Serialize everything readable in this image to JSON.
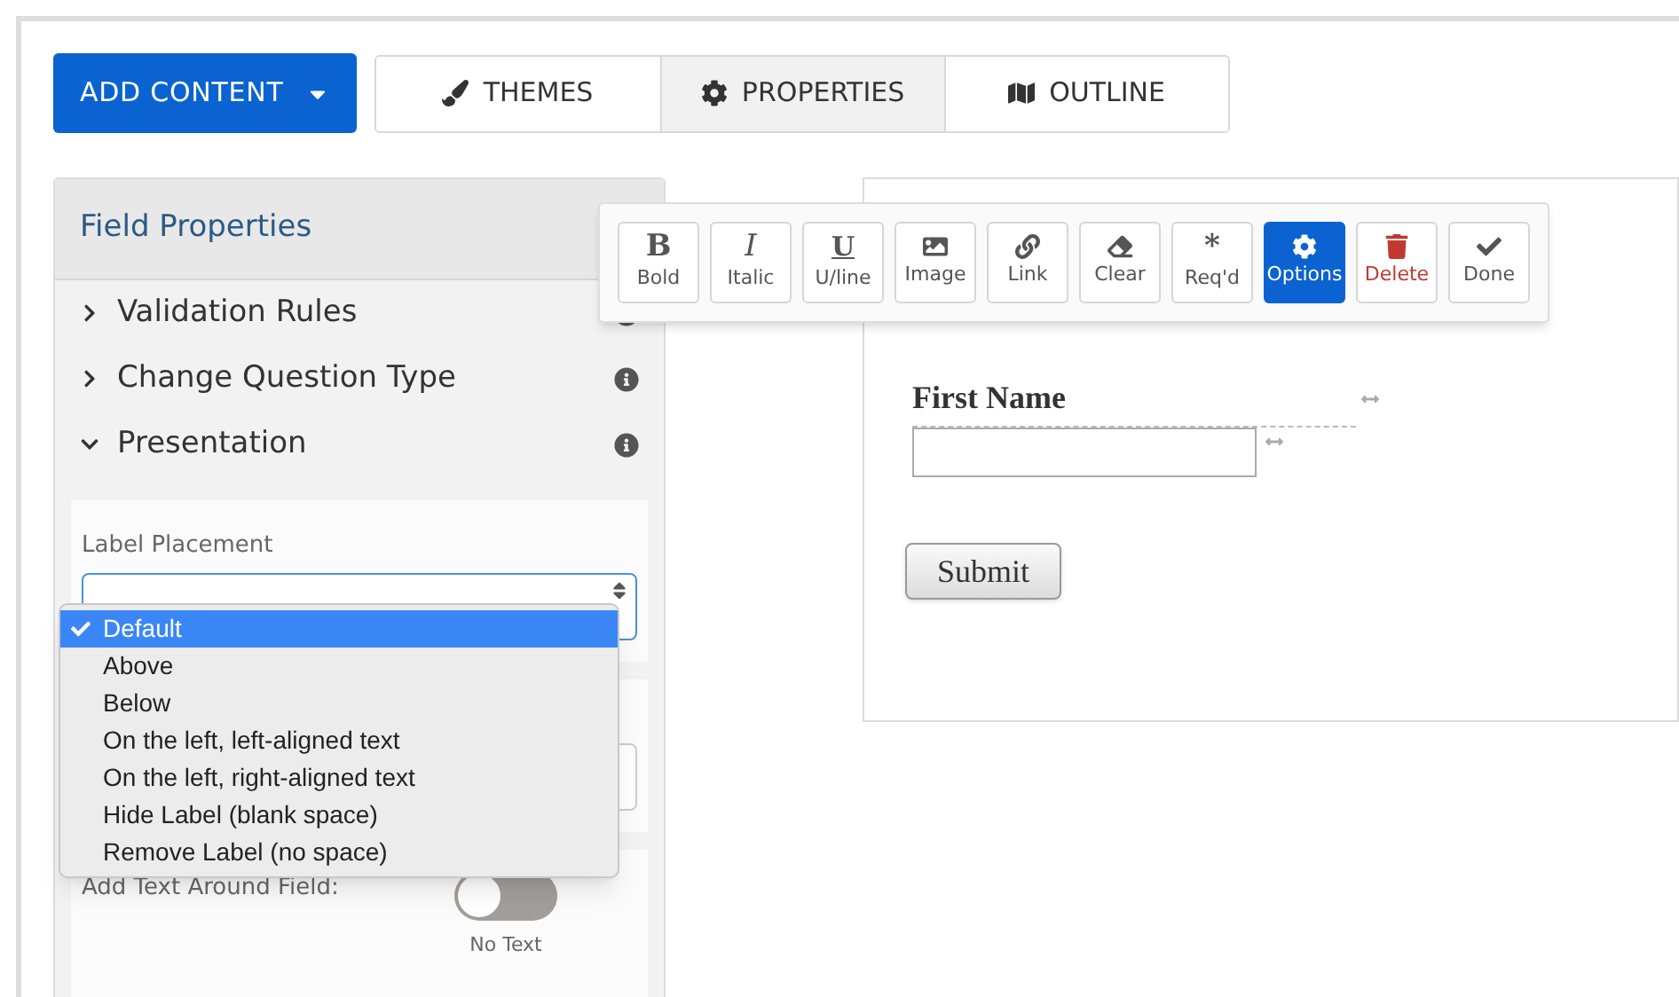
{
  "add_content": {
    "label": "ADD CONTENT"
  },
  "tabs": [
    {
      "label": "THEMES",
      "kind": "brush",
      "selected": false
    },
    {
      "label": "PROPERTIES",
      "kind": "gear",
      "selected": true
    },
    {
      "label": "OUTLINE",
      "kind": "map",
      "selected": false
    }
  ],
  "panel": {
    "title": "Field Properties",
    "sections": [
      {
        "label": "Validation Rules",
        "expanded": false
      },
      {
        "label": "Change Question Type",
        "expanded": false
      },
      {
        "label": "Presentation",
        "expanded": true
      }
    ],
    "label_placement": {
      "label": "Label Placement",
      "options": [
        {
          "label": "Default",
          "selected": true
        },
        {
          "label": "Above",
          "selected": false
        },
        {
          "label": "Below",
          "selected": false
        },
        {
          "label": "On the left, left-aligned text",
          "selected": false
        },
        {
          "label": "On the left, right-aligned text",
          "selected": false
        },
        {
          "label": "Hide Label (blank space)",
          "selected": false
        },
        {
          "label": "Remove Label (no space)",
          "selected": false
        }
      ]
    },
    "text_around": {
      "label": "Add Text Around Field:",
      "on": false,
      "state_label": "No Text"
    }
  },
  "toolbar": [
    {
      "kind": "glyph",
      "glyph": "B",
      "label": "Bold",
      "selected": false
    },
    {
      "kind": "italic",
      "glyph": "I",
      "label": "Italic",
      "selected": false
    },
    {
      "kind": "underline",
      "glyph": "U",
      "label": "U/line",
      "selected": false
    },
    {
      "kind": "image",
      "label": "Image",
      "selected": false
    },
    {
      "kind": "link",
      "label": "Link",
      "selected": false
    },
    {
      "kind": "eraser",
      "label": "Clear",
      "selected": false
    },
    {
      "kind": "glyph",
      "glyph": "*",
      "label": "Req'd",
      "selected": false
    },
    {
      "kind": "gear",
      "label": "Options",
      "selected": true
    },
    {
      "kind": "delete",
      "label": "Delete",
      "selected": false
    },
    {
      "kind": "check",
      "label": "Done",
      "selected": false
    }
  ],
  "form": {
    "field_label": "First Name",
    "submit": "Submit"
  }
}
